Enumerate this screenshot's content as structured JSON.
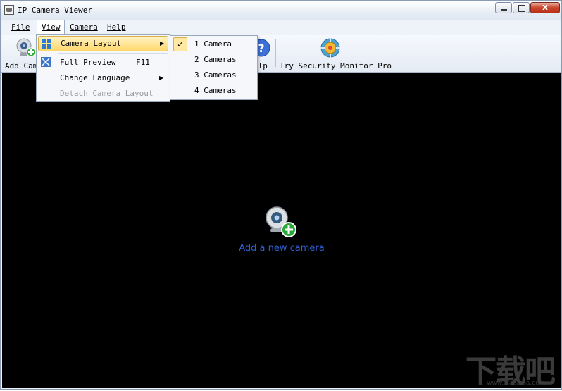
{
  "window": {
    "title": "IP Camera Viewer",
    "close_glyph": "x"
  },
  "menubar": {
    "file": "File",
    "view": "View",
    "camera": "Camera",
    "help": "Help"
  },
  "toolbar": {
    "add_camera": "Add Cam",
    "help": "elp",
    "try_pro": "Try Security Monitor Pro"
  },
  "view_menu": {
    "camera_layout": "Camera Layout",
    "full_preview": "Full Preview",
    "full_preview_shortcut": "F11",
    "change_language": "Change Language",
    "detach_layout": "Detach Camera Layout"
  },
  "layout_menu": {
    "check": "✓",
    "items": [
      "1 Camera",
      "2 Cameras",
      "3 Cameras",
      "4 Cameras"
    ],
    "selected": "1 Camera"
  },
  "main": {
    "add_new_camera": "Add a new camera"
  },
  "watermark": {
    "brand": "下载吧",
    "url": "www.xiazaiba.com"
  },
  "icons": {
    "webcam": "webcam-add-icon",
    "help": "help-icon",
    "pro": "target-icon",
    "grid": "grid-icon",
    "fullscreen": "fullscreen-icon"
  },
  "colors": {
    "link": "#2f5fd0",
    "highlight": "#ffd86b",
    "background": "#000000"
  }
}
